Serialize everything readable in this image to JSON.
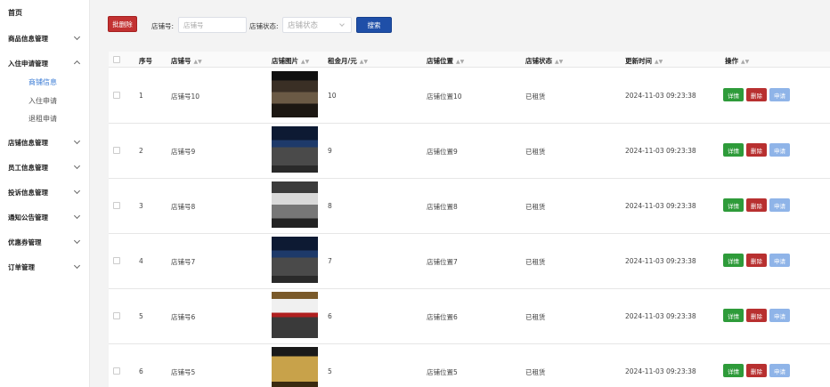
{
  "sidebar": {
    "home": "首页",
    "groups": [
      {
        "label": "商品信息管理",
        "expanded": false
      },
      {
        "label": "入住申请管理",
        "expanded": true
      },
      {
        "label": "店铺信息管理",
        "expanded": false
      },
      {
        "label": "员工信息管理",
        "expanded": false
      },
      {
        "label": "投诉信息管理",
        "expanded": false
      },
      {
        "label": "通知公告管理",
        "expanded": false
      },
      {
        "label": "优惠券管理",
        "expanded": false
      },
      {
        "label": "订单管理",
        "expanded": false
      }
    ],
    "sub_items": [
      "商铺信息",
      "入住申请",
      "退租申请"
    ],
    "active_sub": "商铺信息"
  },
  "toolbar": {
    "delete_label": "批删除",
    "shop_no_label": "店铺号:",
    "shop_no_placeholder": "店铺号",
    "status_label": "店铺状态:",
    "status_placeholder": "店铺状态",
    "search_label": "搜索"
  },
  "table": {
    "headers": [
      "序号",
      "店铺号",
      "店铺图片",
      "租金月/元",
      "店铺位置",
      "店铺状态",
      "更新时间",
      "操作"
    ],
    "rows": [
      {
        "idx": "1",
        "shop_no": "店铺号10",
        "rent": "10",
        "location": "店铺位置10",
        "status": "已租赁",
        "time": "2024-11-03 09:23:38",
        "img": "shop-photo-1"
      },
      {
        "idx": "2",
        "shop_no": "店铺号9",
        "rent": "9",
        "location": "店铺位置9",
        "status": "已租赁",
        "time": "2024-11-03 09:23:38",
        "img": "shop-photo-2"
      },
      {
        "idx": "3",
        "shop_no": "店铺号8",
        "rent": "8",
        "location": "店铺位置8",
        "status": "已租赁",
        "time": "2024-11-03 09:23:38",
        "img": "shop-photo-3"
      },
      {
        "idx": "4",
        "shop_no": "店铺号7",
        "rent": "7",
        "location": "店铺位置7",
        "status": "已租赁",
        "time": "2024-11-03 09:23:38",
        "img": "shop-photo-4"
      },
      {
        "idx": "5",
        "shop_no": "店铺号6",
        "rent": "6",
        "location": "店铺位置6",
        "status": "已租赁",
        "time": "2024-11-03 09:23:38",
        "img": "shop-photo-5"
      },
      {
        "idx": "6",
        "shop_no": "店铺号5",
        "rent": "5",
        "location": "店铺位置5",
        "status": "已租赁",
        "time": "2024-11-03 09:23:38",
        "img": "shop-photo-6"
      }
    ],
    "actions": {
      "detail": "详情",
      "delete": "删除",
      "apply": "申请"
    }
  },
  "colors": {
    "detail": "#2e9b3a",
    "delete": "#b83030",
    "apply": "#8fb4e8",
    "search": "#1f4fa8",
    "active": "#3a7bd5"
  }
}
